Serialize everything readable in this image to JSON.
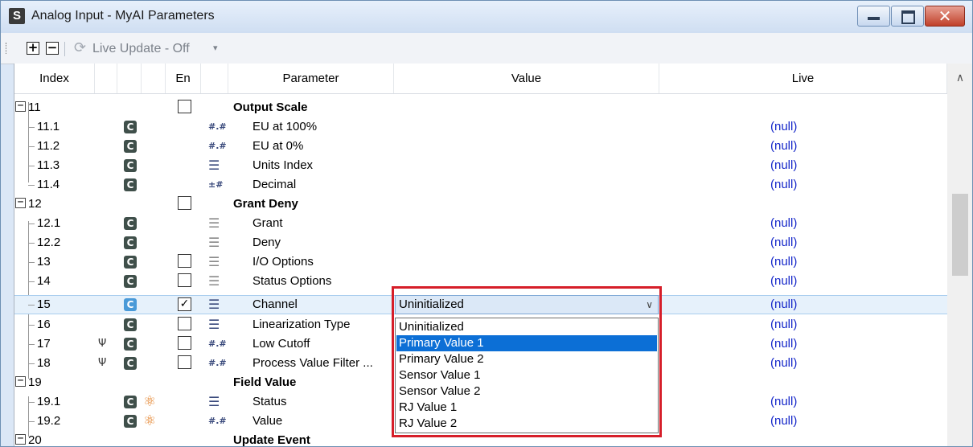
{
  "window": {
    "title": "Analog Input -  MyAI Parameters",
    "icon_letter": "S",
    "close_glyph": "✕"
  },
  "toolbar": {
    "expand_label": "+",
    "collapse_label": "−",
    "live_update_label": "Live Update - Off"
  },
  "columns": {
    "index": "Index",
    "en": "En",
    "parameter": "Parameter",
    "value": "Value",
    "live": "Live"
  },
  "rows": [
    {
      "index": "11",
      "parameter": "Output Scale",
      "group": true
    },
    {
      "index": "11.1",
      "parameter": "EU at 100%",
      "live": "(null)"
    },
    {
      "index": "11.2",
      "parameter": "EU at 0%",
      "live": "(null)"
    },
    {
      "index": "11.3",
      "parameter": "Units Index",
      "live": "(null)"
    },
    {
      "index": "11.4",
      "parameter": "Decimal",
      "live": "(null)"
    },
    {
      "index": "12",
      "parameter": "Grant Deny",
      "group": true
    },
    {
      "index": "12.1",
      "parameter": "Grant",
      "live": "(null)"
    },
    {
      "index": "12.2",
      "parameter": "Deny",
      "live": "(null)"
    },
    {
      "index": "13",
      "parameter": "I/O Options",
      "live": "(null)"
    },
    {
      "index": "14",
      "parameter": "Status Options",
      "live": "(null)"
    },
    {
      "index": "15",
      "parameter": "Channel",
      "live": "(null)",
      "checked": "✓"
    },
    {
      "index": "16",
      "parameter": "Linearization Type",
      "live": "(null)"
    },
    {
      "index": "17",
      "parameter": "Low Cutoff",
      "live": "(null)"
    },
    {
      "index": "18",
      "parameter": "Process Value Filter ...",
      "live": "(null)"
    },
    {
      "index": "19",
      "parameter": "Field Value",
      "group": true
    },
    {
      "index": "19.1",
      "parameter": "Status",
      "live": "(null)"
    },
    {
      "index": "19.2",
      "parameter": "Value",
      "live": "(null)"
    },
    {
      "index": "20",
      "parameter": "Update Event",
      "group": true
    }
  ],
  "dropdown": {
    "selected": "Uninitialized",
    "options": [
      "Uninitialized",
      "Primary Value 1",
      "Primary Value 2",
      "Sensor Value 1",
      "Sensor Value 2",
      "RJ Value 1",
      "RJ Value 2"
    ],
    "highlighted": "Primary Value 1"
  },
  "icons": {
    "config": "C",
    "float": "#.#",
    "int": "±#",
    "list": "☰",
    "atom": "⚛",
    "lock": "Ψ",
    "expand": "−",
    "scroll_up": "∧",
    "dd_arrow": "∨",
    "live_icon": "⟳",
    "toolbar_arrow": "▾"
  },
  "colors": {
    "null_text": "#1426c9",
    "highlight": "#0c6fd6",
    "frame": "#d61e29"
  }
}
